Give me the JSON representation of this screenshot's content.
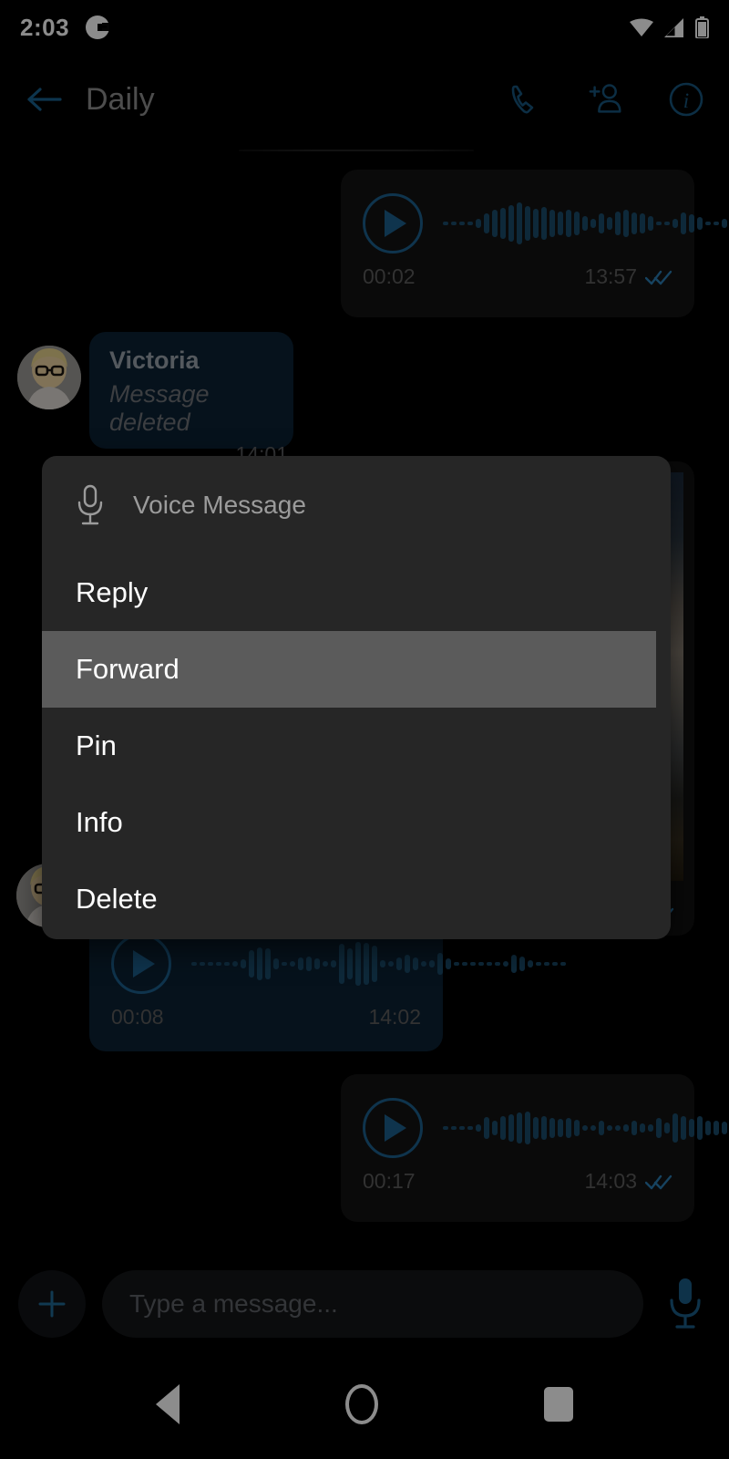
{
  "status_bar": {
    "time": "2:03",
    "logo_icon": "g-logo-icon",
    "wifi_icon": "wifi-icon",
    "signal_icon": "cellular-signal-icon",
    "battery_icon": "battery-icon"
  },
  "header": {
    "back_icon": "arrow-left-icon",
    "title": "Daily",
    "call_icon": "phone-icon",
    "add_member_icon": "add-person-icon",
    "info_icon": "info-circle-icon",
    "accent": "#1c5f8c",
    "title_color": "#8c8c8c"
  },
  "messages": [
    {
      "type": "voice",
      "direction": "outgoing",
      "duration": "00:02",
      "time": "13:57",
      "status": "read",
      "play_icon": "play-icon"
    },
    {
      "type": "text",
      "direction": "incoming",
      "sender": "Victoria",
      "body": "Message deleted",
      "time": "14:01",
      "avatar_icon": "avatar"
    },
    {
      "type": "photo",
      "direction": "outgoing",
      "status": "read"
    },
    {
      "type": "voice",
      "direction": "incoming",
      "duration": "00:08",
      "time": "14:02",
      "play_icon": "play-icon",
      "avatar_icon": "avatar"
    },
    {
      "type": "voice",
      "direction": "outgoing",
      "duration": "00:17",
      "time": "14:03",
      "status": "read",
      "play_icon": "play-icon"
    }
  ],
  "context_menu": {
    "header_icon": "microphone-icon",
    "header_label": "Voice Message",
    "items": [
      {
        "label": "Reply",
        "selected": false
      },
      {
        "label": "Forward",
        "selected": true
      },
      {
        "label": "Pin",
        "selected": false
      },
      {
        "label": "Info",
        "selected": false
      },
      {
        "label": "Delete",
        "selected": false
      }
    ],
    "background": "#262626",
    "highlight": "#5b5b5b"
  },
  "input_bar": {
    "attach_icon": "plus-icon",
    "placeholder": "Type a message...",
    "value": "",
    "mic_icon": "microphone-icon"
  },
  "nav_bar": {
    "back_icon": "nav-back-icon",
    "home_icon": "nav-home-icon",
    "recents_icon": "nav-recents-icon"
  },
  "waveforms": {
    "msg1": [
      4,
      4,
      4,
      4,
      10,
      22,
      30,
      34,
      40,
      46,
      38,
      32,
      36,
      30,
      26,
      30,
      26,
      16,
      10,
      22,
      14,
      26,
      30,
      24,
      22,
      16,
      4,
      4,
      10,
      24,
      20,
      14,
      4,
      4,
      10,
      26,
      32,
      28,
      30,
      32,
      30,
      28
    ],
    "msg4": [
      4,
      4,
      4,
      4,
      4,
      6,
      10,
      30,
      36,
      34,
      12,
      4,
      6,
      14,
      16,
      12,
      6,
      8,
      44,
      34,
      48,
      46,
      40,
      8,
      6,
      14,
      20,
      14,
      6,
      8,
      24,
      12,
      4,
      4,
      4,
      4,
      4,
      4,
      6,
      20,
      16,
      8,
      4,
      4,
      4,
      4
    ],
    "msg5": [
      4,
      4,
      4,
      4,
      8,
      24,
      16,
      26,
      30,
      34,
      36,
      24,
      26,
      22,
      20,
      22,
      18,
      6,
      6,
      16,
      6,
      6,
      8,
      16,
      10,
      8,
      22,
      12,
      32,
      26,
      20,
      26,
      16,
      16,
      14,
      10,
      10,
      12,
      6,
      4,
      4,
      18,
      8,
      6
    ]
  }
}
